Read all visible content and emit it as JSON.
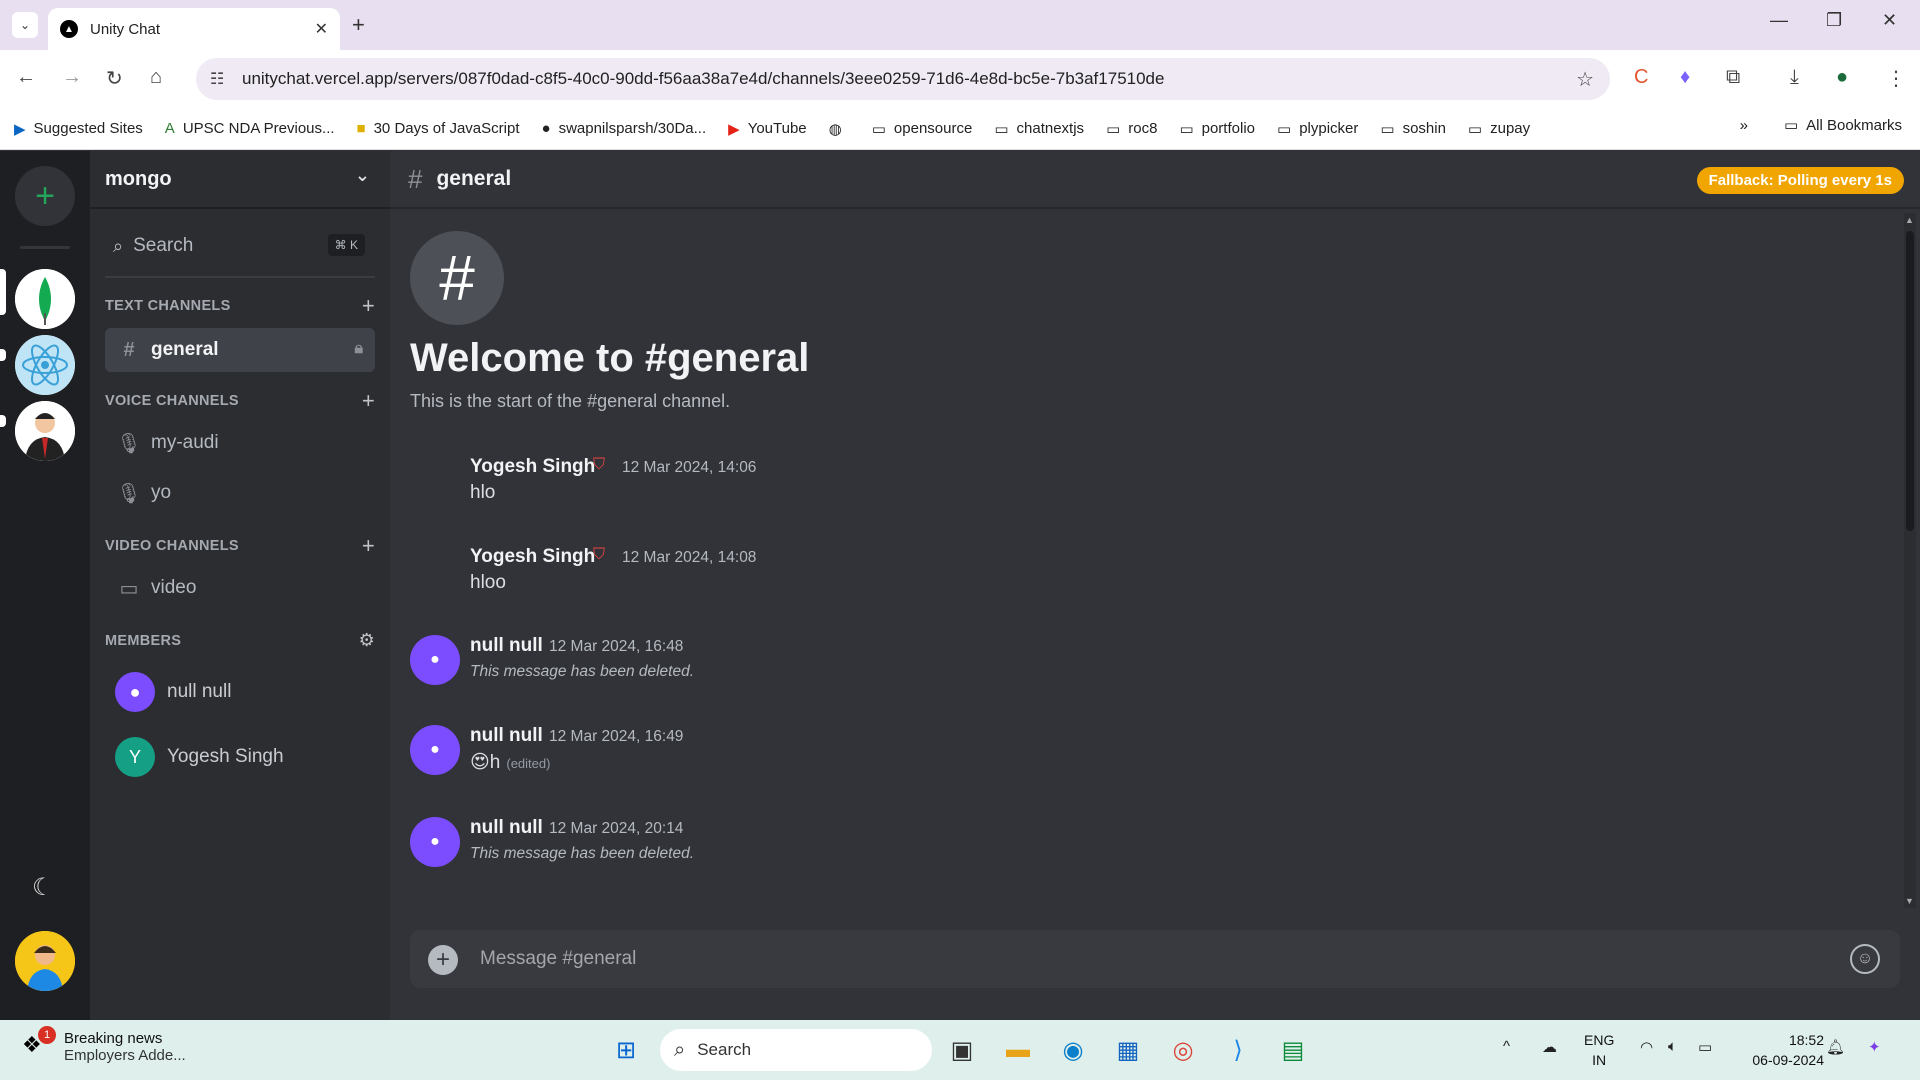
{
  "browser": {
    "tab_title": "Unity Chat",
    "url": "unitychat.vercel.app/servers/087f0dad-c8f5-40c0-90dd-f56aa38a7e4d/channels/3eee0259-71d6-4e8d-bc5e-7b3af17510de",
    "bookmarks": [
      "Suggested Sites",
      "UPSC NDA Previous...",
      "30 Days of JavaScript",
      "swapnilsparsh/30Da...",
      "YouTube",
      "",
      "opensource",
      "chatnextjs",
      "roc8",
      "portfolio",
      "plypicker",
      "soshin",
      "zupay"
    ],
    "all_bookmarks": "All Bookmarks"
  },
  "sidebar": {
    "server_name": "mongo",
    "search_label": "Search",
    "search_shortcut": "⌘ K",
    "text_channels_label": "TEXT CHANNELS",
    "text_channels": [
      {
        "name": "general"
      }
    ],
    "voice_channels_label": "VOICE CHANNELS",
    "voice_channels": [
      {
        "name": "my-audi"
      },
      {
        "name": "yo"
      }
    ],
    "video_channels_label": "VIDEO CHANNELS",
    "video_channels": [
      {
        "name": "video"
      }
    ],
    "members_label": "MEMBERS",
    "members": [
      {
        "name": "null null",
        "initial": ""
      },
      {
        "name": "Yogesh Singh",
        "initial": "Y"
      }
    ]
  },
  "main": {
    "channel_name": "general",
    "fallback_badge": "Fallback: Polling every 1s",
    "welcome_title": "Welcome to #general",
    "welcome_sub": "This is the start of the #general channel.",
    "messages": [
      {
        "author": "Yogesh Singh",
        "time": "12 Mar 2024, 14:06",
        "text": "hlo",
        "edited": ""
      },
      {
        "author": "Yogesh Singh",
        "time": "12 Mar 2024, 14:08",
        "text": "hloo",
        "edited": ""
      },
      {
        "author": "null null",
        "time": "12 Mar 2024, 16:48",
        "text": "This message has been deleted.",
        "edited": ""
      },
      {
        "author": "null null",
        "time": "12 Mar 2024, 16:49",
        "text": "😍h",
        "edited": "(edited)"
      },
      {
        "author": "null null",
        "time": "12 Mar 2024, 20:14",
        "text": "This message has been deleted.",
        "edited": ""
      }
    ],
    "composer_placeholder": "Message #general"
  },
  "taskbar": {
    "news_title": "Breaking news",
    "news_sub": "Employers Adde...",
    "news_count": "1",
    "search_label": "Search",
    "lang1": "ENG",
    "lang2": "IN",
    "time": "18:52",
    "date": "06-09-2024"
  },
  "colors": {
    "accent_green": "#23a55a",
    "fallback_orange": "#f0a500",
    "avatar_purple": "#7c4dff",
    "avatar_teal": "#15a085"
  }
}
